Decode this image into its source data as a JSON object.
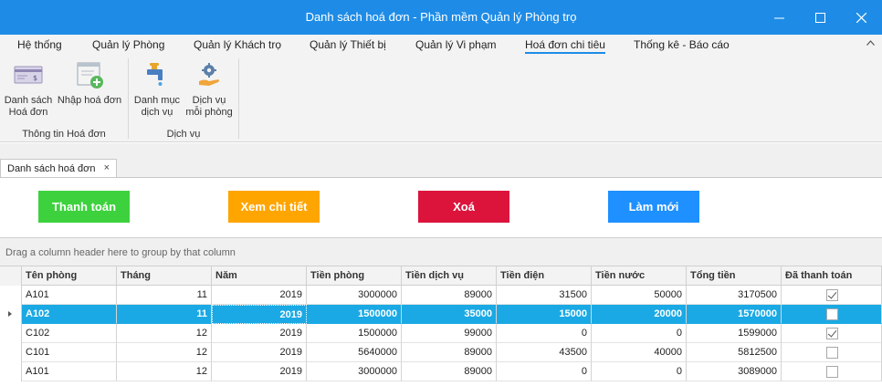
{
  "window": {
    "title": "Danh sách hoá đơn - Phần mềm Quản lý Phòng trọ",
    "accent": "#1e8ce6"
  },
  "ribbon": {
    "tabs": [
      {
        "label": "Hệ thống"
      },
      {
        "label": "Quản lý Phòng"
      },
      {
        "label": "Quản lý Khách trọ"
      },
      {
        "label": "Quản lý Thiết bị"
      },
      {
        "label": "Quản lý Vi phạm"
      },
      {
        "label": "Hoá đơn chi tiêu",
        "active": true
      },
      {
        "label": "Thống kê - Báo cáo"
      }
    ],
    "collapse_icon": "chevron-up-icon",
    "buttons": [
      {
        "line1": "Danh sách",
        "line2": "Hoá đơn",
        "icon": "invoice-list-icon"
      },
      {
        "line1": "Nhập hoá đơn",
        "line2": "",
        "icon": "add-invoice-icon"
      },
      {
        "line1": "Danh mục",
        "line2": "dịch vụ",
        "icon": "faucet-icon"
      },
      {
        "line1": "Dịch vụ",
        "line2": "mỗi phòng",
        "icon": "gear-hand-icon"
      }
    ],
    "groups": [
      {
        "label": "Thông tin Hoá đơn"
      },
      {
        "label": "Dịch vụ"
      }
    ]
  },
  "document_tab": {
    "label": "Danh sách hoá đơn",
    "close": "×"
  },
  "actions": [
    {
      "label": "Thanh toán",
      "color": "#3dd23d"
    },
    {
      "label": "Xem chi tiết",
      "color": "#ffa500"
    },
    {
      "label": "Xoá",
      "color": "#dc143c"
    },
    {
      "label": "Làm mới",
      "color": "#1e90ff"
    }
  ],
  "group_panel": {
    "text": "Drag a column header here to group by that column"
  },
  "grid": {
    "columns": [
      "Tên phòng",
      "Tháng",
      "Năm",
      "Tiền phòng",
      "Tiền dịch vụ",
      "Tiền điện",
      "Tiền nước",
      "Tổng tiền",
      "Đã thanh toán"
    ],
    "rows": [
      {
        "cells": [
          "A101",
          "11",
          "2019",
          "3000000",
          "89000",
          "31500",
          "50000",
          "3170500"
        ],
        "paid": true
      },
      {
        "cells": [
          "A102",
          "11",
          "2019",
          "1500000",
          "35000",
          "15000",
          "20000",
          "1570000"
        ],
        "paid": false,
        "selected": true
      },
      {
        "cells": [
          "C102",
          "12",
          "2019",
          "1500000",
          "99000",
          "0",
          "0",
          "1599000"
        ],
        "paid": true
      },
      {
        "cells": [
          "C101",
          "12",
          "2019",
          "5640000",
          "89000",
          "43500",
          "40000",
          "5812500"
        ],
        "paid": false
      },
      {
        "cells": [
          "A101",
          "12",
          "2019",
          "3000000",
          "89000",
          "0",
          "0",
          "3089000"
        ],
        "paid": false
      }
    ],
    "selection_color": "#1aa9e4"
  }
}
